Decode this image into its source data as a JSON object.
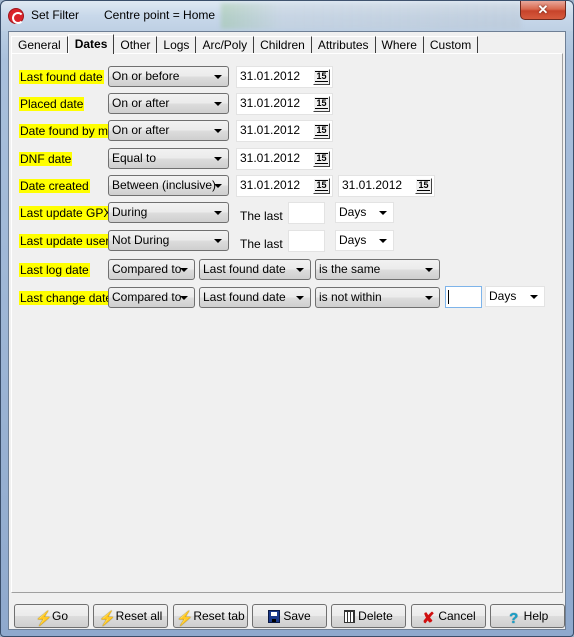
{
  "window": {
    "title": "Set Filter",
    "subtitle": "Centre point = Home",
    "close_label": "✕"
  },
  "tabs": [
    {
      "label": "General",
      "active": false
    },
    {
      "label": "Dates",
      "active": true
    },
    {
      "label": "Other",
      "active": false
    },
    {
      "label": "Logs",
      "active": false
    },
    {
      "label": "Arc/Poly",
      "active": false
    },
    {
      "label": "Children",
      "active": false
    },
    {
      "label": "Attributes",
      "active": false
    },
    {
      "label": "Where",
      "active": false
    },
    {
      "label": "Custom",
      "active": false
    }
  ],
  "rows": {
    "last_found": {
      "label": "Last found date",
      "operator": "On or before",
      "date1": "31.01.2012"
    },
    "placed": {
      "label": "Placed date",
      "operator": "On or after",
      "date1": "31.01.2012"
    },
    "found_by_me": {
      "label": "Date found by me",
      "operator": "On or after",
      "date1": "31.01.2012"
    },
    "dnf": {
      "label": "DNF date",
      "operator": "Equal to",
      "date1": "31.01.2012"
    },
    "created": {
      "label": "Date created",
      "operator": "Between (inclusive)",
      "date1": "31.01.2012",
      "date2": "31.01.2012"
    },
    "update_gpx": {
      "label": "Last update GPX",
      "operator": "During",
      "the_last": "The last",
      "amount": "",
      "unit": "Days"
    },
    "update_user": {
      "label": "Last update user",
      "operator": "Not During",
      "the_last": "The last",
      "amount": "",
      "unit": "Days"
    },
    "last_log": {
      "label": "Last log date",
      "operator": "Compared to",
      "compare_field": "Last found date",
      "relation": "is the same"
    },
    "last_change": {
      "label": "Last change date",
      "operator": "Compared to",
      "compare_field": "Last found date",
      "relation": "is not within",
      "amount": "",
      "unit": "Days"
    }
  },
  "calendar_icon_text": "15",
  "buttons": {
    "go": "Go",
    "reset_all": "Reset all",
    "reset_tab": "Reset tab",
    "save": "Save",
    "delete": "Delete",
    "cancel": "Cancel",
    "help": "Help"
  },
  "icons": {
    "bolt": "⚡",
    "cancel": "✘",
    "help": "?"
  },
  "colors": {
    "label_highlight": "#ffff00",
    "close_button": "#c7432b"
  }
}
